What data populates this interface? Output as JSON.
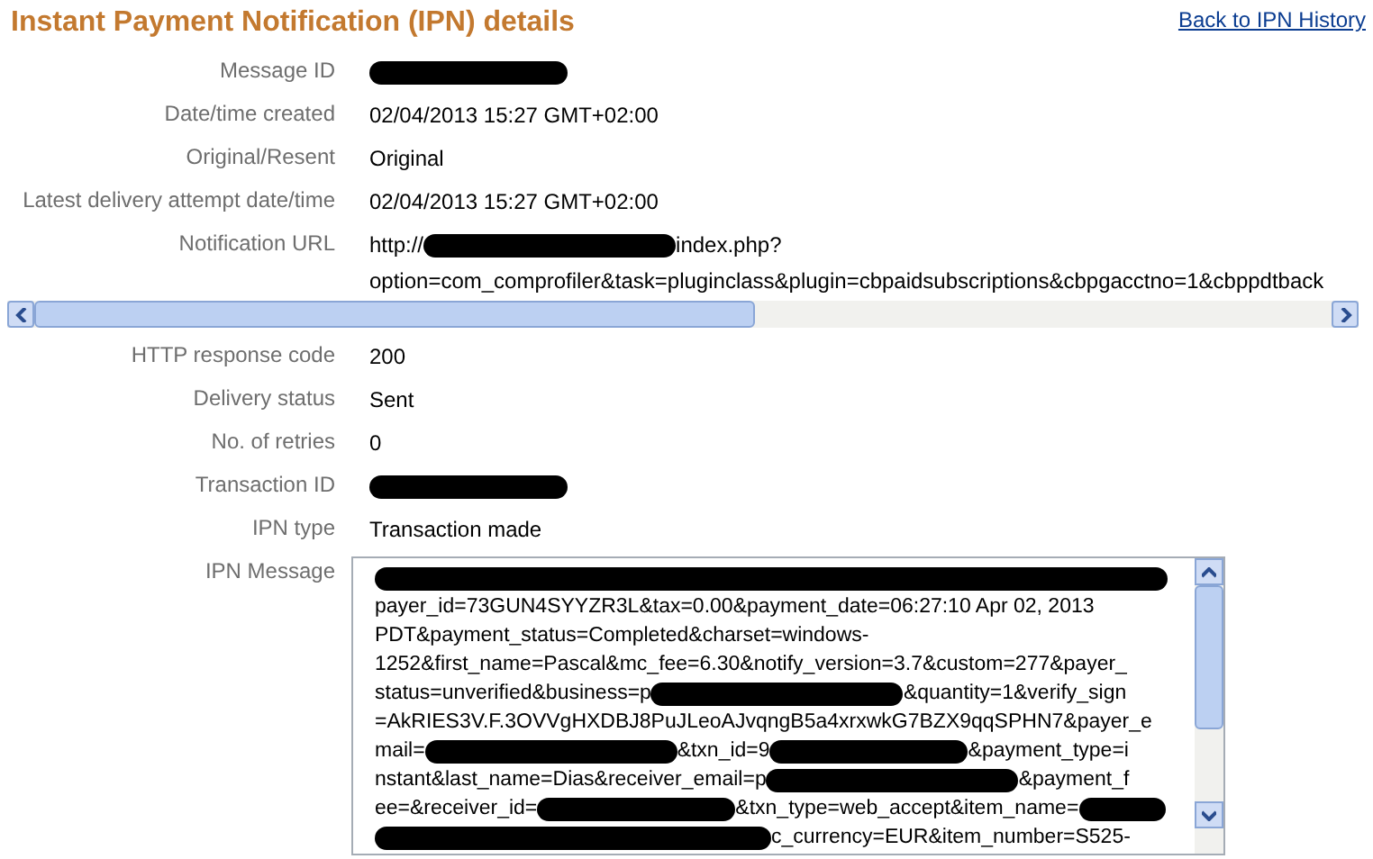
{
  "header": {
    "title": "Instant Payment Notification (IPN) details",
    "back_link": "Back to IPN History"
  },
  "fields_top": [
    {
      "label": "Message ID",
      "value": [
        {
          "kind": "redacted_medium"
        }
      ]
    },
    {
      "label": "Date/time created",
      "value": [
        {
          "kind": "text",
          "text": "02/04/2013 15:27 GMT+02:00"
        }
      ]
    },
    {
      "label": "Original/Resent",
      "value": [
        {
          "kind": "text",
          "text": "Original"
        }
      ]
    },
    {
      "label": "Latest delivery attempt date/time",
      "value": [
        {
          "kind": "text",
          "text": "02/04/2013 15:27 GMT+02:00"
        }
      ]
    },
    {
      "label": "Notification URL",
      "value": [
        {
          "kind": "text",
          "text": "http://"
        },
        {
          "kind": "redacted_long"
        },
        {
          "kind": "text",
          "text": "index.php?"
        }
      ],
      "continuation": "option=com_comprofiler&task=pluginclass&plugin=cbpaidsubscriptions&cbpgacctno=1&cbppdtback"
    }
  ],
  "fields_bottom": [
    {
      "label": "HTTP response code",
      "value": [
        {
          "kind": "text",
          "text": "200"
        }
      ]
    },
    {
      "label": "Delivery status",
      "value": [
        {
          "kind": "text",
          "text": "Sent"
        }
      ]
    },
    {
      "label": "No. of retries",
      "value": [
        {
          "kind": "text",
          "text": "0"
        }
      ]
    },
    {
      "label": "Transaction ID",
      "value": [
        {
          "kind": "redacted_medium"
        }
      ]
    },
    {
      "label": "IPN type",
      "value": [
        {
          "kind": "text",
          "text": "Transaction made"
        }
      ]
    }
  ],
  "ipn_message": {
    "label": "IPN Message",
    "lines": [
      [
        {
          "kind": "redacted_full"
        }
      ],
      [
        {
          "kind": "text",
          "text": "payer_id=73GUN4SYYZR3L&tax=0.00&payment_date=06:27:10 Apr 02, 2013"
        }
      ],
      [
        {
          "kind": "text",
          "text": "PDT&payment_status=Completed&charset=windows-"
        }
      ],
      [
        {
          "kind": "text",
          "text": "1252&first_name=Pascal&mc_fee=6.30&notify_version=3.7&custom=277&payer_"
        }
      ],
      [
        {
          "kind": "text",
          "text": "status=unverified&business=p"
        },
        {
          "kind": "redacted_long"
        },
        {
          "kind": "text",
          "text": "&quantity=1&verify_sign"
        }
      ],
      [
        {
          "kind": "text",
          "text": "=AkRIES3V.F.3OVVgHXDBJ8PuJLeoAJvqngB5a4xrxwkG7BZX9qqSPHN7&payer_e"
        }
      ],
      [
        {
          "kind": "text",
          "text": "mail="
        },
        {
          "kind": "redacted_long"
        },
        {
          "kind": "text",
          "text": "&txn_id=9"
        },
        {
          "kind": "redacted_medium"
        },
        {
          "kind": "text",
          "text": "&payment_type=i"
        }
      ],
      [
        {
          "kind": "text",
          "text": "nstant&last_name=Dias&receiver_email=p"
        },
        {
          "kind": "redacted_long"
        },
        {
          "kind": "text",
          "text": "&payment_f"
        }
      ],
      [
        {
          "kind": "text",
          "text": "ee=&receiver_id="
        },
        {
          "kind": "redacted_medium"
        },
        {
          "kind": "text",
          "text": "&txn_type=web_accept&item_name="
        },
        {
          "kind": "redacted_short"
        }
      ],
      [
        {
          "kind": "redacted_xlong"
        },
        {
          "kind": "text",
          "text": "c_currency=EUR&item_number=S525-"
        }
      ]
    ]
  }
}
